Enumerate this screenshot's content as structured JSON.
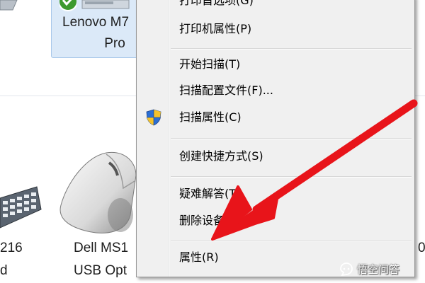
{
  "devices": {
    "lenovo": {
      "line1": "Lenovo M7",
      "line2": "Pro"
    },
    "keyboard": {
      "line1": "216",
      "line2": "d"
    },
    "dell_mouse": {
      "line1": "Dell MS1",
      "line2": "USB Opt"
    },
    "right_partial": "0"
  },
  "context_menu": {
    "items": [
      {
        "label": "打印首选项(G)",
        "icon": null
      },
      {
        "label": "打印机属性(P)",
        "icon": null
      },
      {
        "label": "开始扫描(T)",
        "icon": null
      },
      {
        "label": "扫描配置文件(F)...",
        "icon": null
      },
      {
        "label": "扫描属性(C)",
        "icon": "uac-shield-icon"
      },
      {
        "label": "创建快捷方式(S)",
        "icon": null
      },
      {
        "label": "疑难解答(T)",
        "icon": null
      },
      {
        "label": "删除设备",
        "icon": null
      },
      {
        "label": "属性(R)",
        "icon": null
      }
    ]
  },
  "annotation": {
    "arrow_color": "#e8141a",
    "points_to": "属性(R)"
  },
  "watermark": {
    "text": "悟空问答",
    "icon": "wukong-icon"
  },
  "colors": {
    "menu_bg": "#f0f0f0",
    "selected_tile_bg": "#dbe9f8",
    "arrow": "#e8141a"
  }
}
